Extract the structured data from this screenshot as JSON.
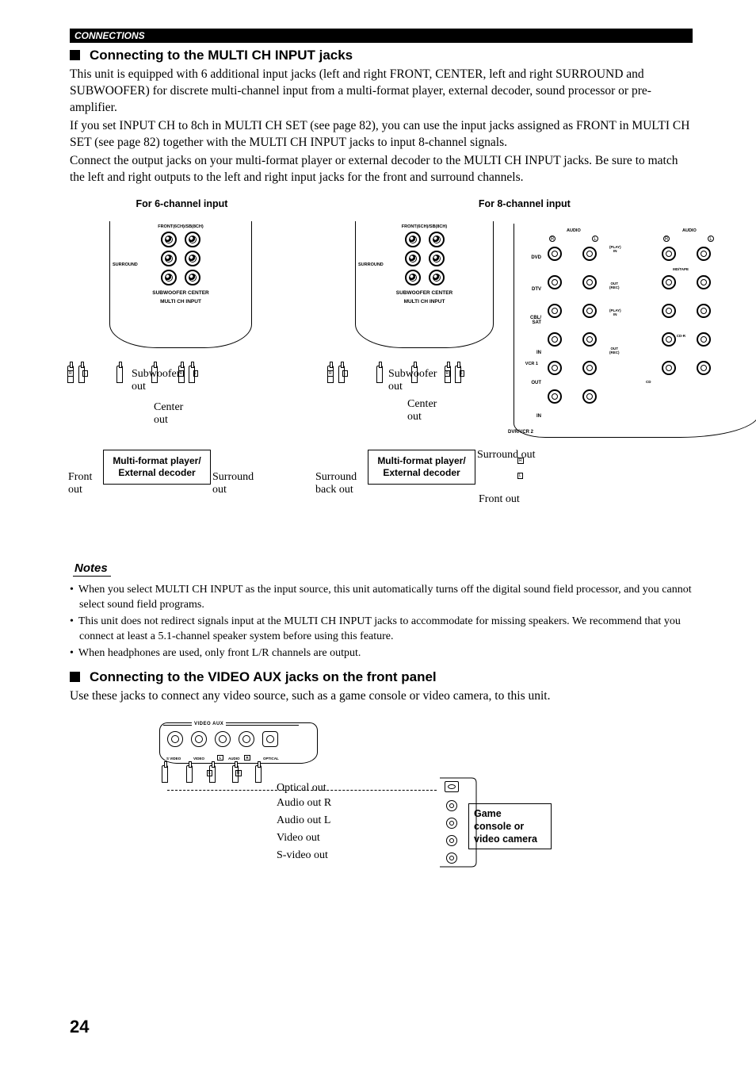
{
  "header": "CONNECTIONS",
  "section1": {
    "title": "Connecting to the MULTI CH INPUT jacks",
    "para1": "This unit is equipped with 6 additional input jacks (left and right FRONT, CENTER, left and right SURROUND and SUBWOOFER) for discrete multi-channel input from a multi-format player, external decoder, sound processor or pre-amplifier.",
    "para2": "If you set INPUT CH to 8ch in MULTI CH SET (see page 82), you can use the input jacks assigned as FRONT in MULTI CH SET (see page 82) together with the MULTI CH INPUT jacks to input 8-channel signals.",
    "para3": "Connect the output jacks on your multi-format player or external decoder to the MULTI CH INPUT jacks. Be sure to match the left and right outputs to the left and right input jacks for the front and surround channels."
  },
  "captions": {
    "six": "For 6-channel input",
    "eight": "For 8-channel input"
  },
  "jack_panel": {
    "top": "FRONT(6CH)/SB(8CH)",
    "surround": "SURROUND",
    "bottom": "SUBWOOFER   CENTER",
    "title": "MULTI CH INPUT"
  },
  "decoder": {
    "line1": "Multi-format player/",
    "line2": "External decoder"
  },
  "callouts": {
    "sub": "Subwoofer",
    "out": "out",
    "center": "Center",
    "front": "Front",
    "surround": "Surround",
    "surround_out": "Surround out",
    "surround_back": "Surround",
    "back_out": "back out",
    "front_out": "Front out"
  },
  "rl": {
    "r": "R",
    "l": "L"
  },
  "audio_panel": {
    "head": "AUDIO",
    "dvd": "DVD",
    "dtv": "DTV",
    "cbl": "CBL/\nSAT",
    "in": "IN",
    "out": "OUT",
    "vcr1": "VCR 1",
    "dvr": "DVR/VCR 2",
    "mdtape": "MD/TAPE",
    "cdr": "CD-R",
    "cd": "CD",
    "play_in": "(PLAY)\nIN",
    "out_rec": "OUT\n(REC)"
  },
  "notes": {
    "title": "Notes",
    "items": [
      "When you select MULTI CH INPUT as the input source, this unit automatically turns off the digital sound field processor, and you cannot select sound field programs.",
      "This unit does not redirect signals input at the MULTI CH INPUT jacks to accommodate for missing speakers. We recommend that you connect at least a 5.1-channel speaker system before using this feature.",
      "When headphones are used, only front L/R channels are output."
    ]
  },
  "section2": {
    "title": "Connecting to the VIDEO AUX jacks on the front panel",
    "para": "Use these jacks to connect any video source, such as a game console or video camera, to this unit."
  },
  "aux": {
    "head": "VIDEO AUX",
    "svideo": "S VIDEO",
    "video": "VIDEO",
    "audio": "AUDIO",
    "optical": "OPTICAL",
    "opt_out": "Optical out",
    "audio_r": "Audio out R",
    "audio_l": "Audio out L",
    "video_out": "Video out",
    "svideo_out": "S-video out",
    "dev1": "Game",
    "dev2": "console or",
    "dev3": "video camera"
  },
  "page": "24"
}
